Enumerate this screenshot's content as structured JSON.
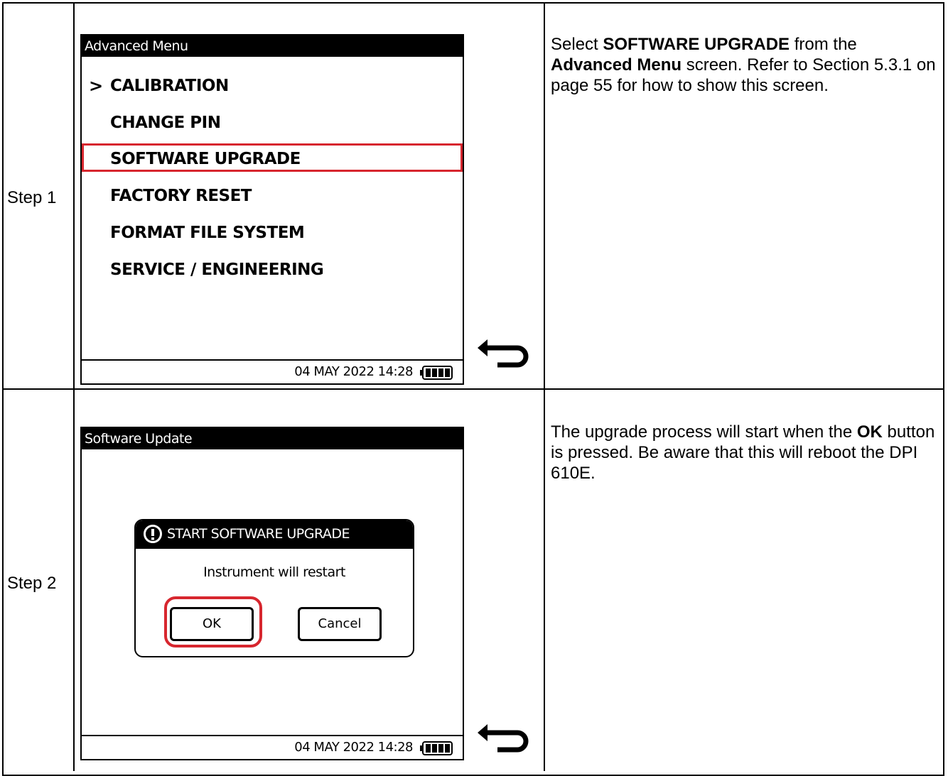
{
  "steps": [
    {
      "label": "Step 1",
      "screen": {
        "title": "Advanced Menu",
        "menu": [
          "CALIBRATION",
          "CHANGE PIN",
          "SOFTWARE UPGRADE",
          "FACTORY RESET",
          "FORMAT FILE SYSTEM",
          "SERVICE / ENGINEERING"
        ],
        "selected_marker": ">",
        "datetime": "04 MAY 2022 14:28"
      },
      "description": {
        "part1": "Select ",
        "bold1": "SOFTWARE UPGRADE",
        "part2": " from the ",
        "bold2": "Advanced Menu",
        "part3": " screen. Refer to Section 5.3.1 on page 55 for how to show this screen."
      }
    },
    {
      "label": "Step 2",
      "screen": {
        "title": "Software Update",
        "dialog_title": "START SOFTWARE UPGRADE",
        "dialog_message": "Instrument will restart",
        "ok_label": "OK",
        "cancel_label": "Cancel",
        "datetime": "04 MAY 2022 14:28"
      },
      "description": {
        "part1": "The upgrade process will start when the ",
        "bold1": "OK",
        "part2": " button is pressed. Be aware that this will reboot the DPI 610E."
      }
    }
  ],
  "colors": {
    "highlight": "#d7262e"
  },
  "icons": {
    "back": "back-arrow-icon",
    "battery": "battery-icon",
    "alert": "exclamation-circle-icon"
  }
}
